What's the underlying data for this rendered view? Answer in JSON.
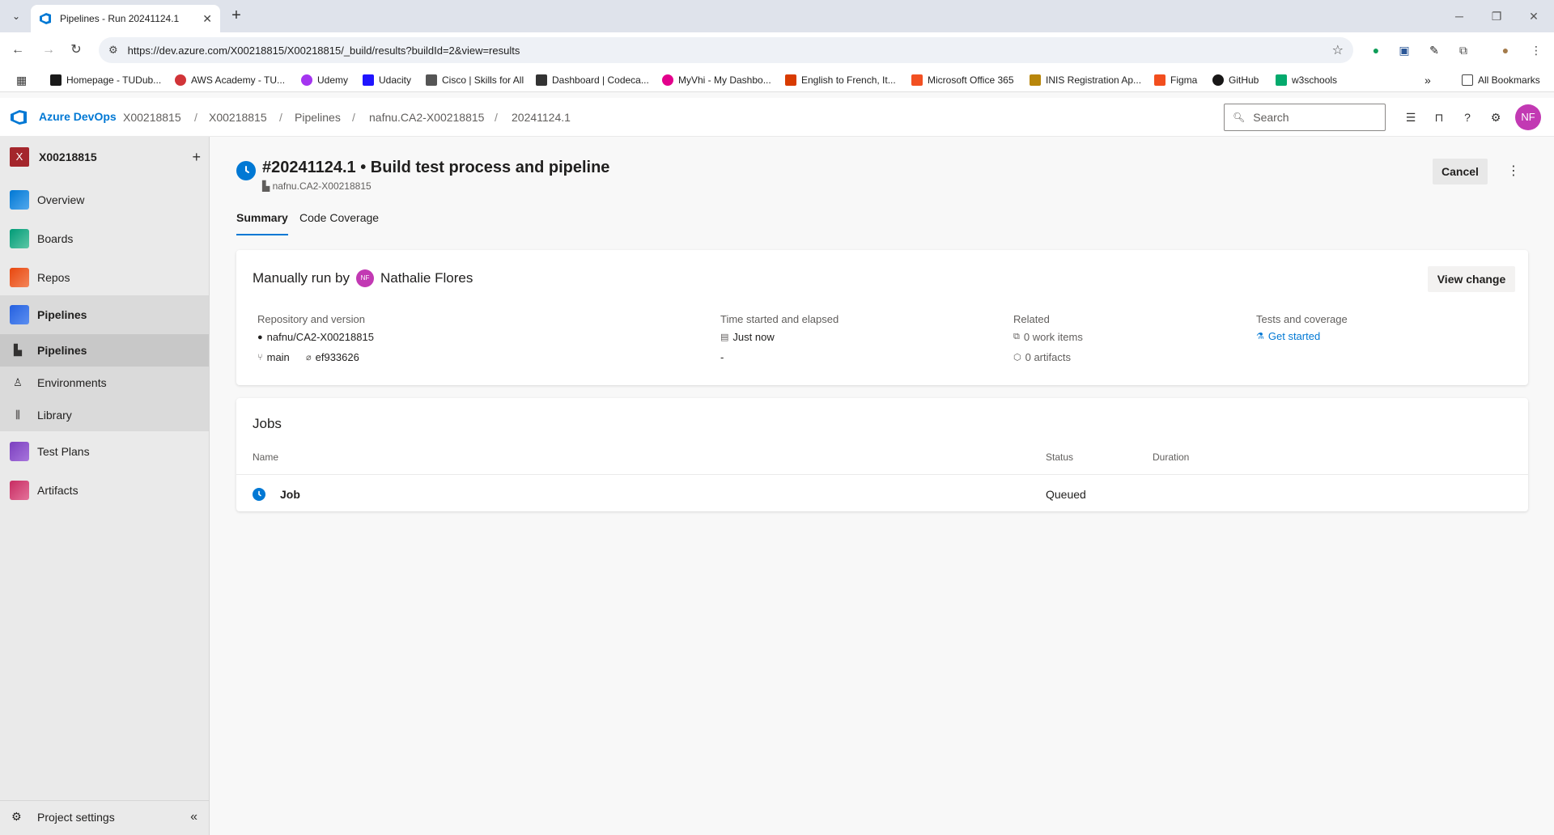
{
  "browser": {
    "tab_title": "Pipelines - Run 20241124.1",
    "url": "https://dev.azure.com/X00218815/X00218815/_build/results?buildId=2&view=results",
    "bookmarks": [
      {
        "label": "Homepage - TUDub...",
        "color": "#1a1a1a"
      },
      {
        "label": "AWS Academy - TU...",
        "color": "#d13438"
      },
      {
        "label": "Udemy",
        "color": "#a435f0"
      },
      {
        "label": "Udacity",
        "color": "#2015ff"
      },
      {
        "label": "Cisco | Skills for All",
        "color": "#555555"
      },
      {
        "label": "Dashboard | Codeca...",
        "color": "#333333"
      },
      {
        "label": "MyVhi - My Dashbo...",
        "color": "#e3008c"
      },
      {
        "label": "English to French, It...",
        "color": "#d83b01"
      },
      {
        "label": "Microsoft Office 365",
        "color": "#f25022"
      },
      {
        "label": "INIS Registration Ap...",
        "color": "#b8860b"
      },
      {
        "label": "Figma",
        "color": "#f24e1e"
      },
      {
        "label": "GitHub",
        "color": "#181717"
      },
      {
        "label": "w3schools",
        "color": "#04aa6d"
      }
    ],
    "all_bookmarks": "All Bookmarks"
  },
  "header": {
    "brand": "Azure DevOps",
    "breadcrumbs": [
      "X00218815",
      "X00218815",
      "Pipelines",
      "nafnu.CA2-X00218815",
      "20241124.1"
    ],
    "search_placeholder": "Search",
    "user_initials": "NF"
  },
  "sidebar": {
    "project_initial": "X",
    "project_name": "X00218815",
    "items": [
      {
        "label": "Overview",
        "icon": "overview-icon",
        "color": "#0078d4"
      },
      {
        "label": "Boards",
        "icon": "boards-icon",
        "color": "#009b77"
      },
      {
        "label": "Repos",
        "icon": "repos-icon",
        "color": "#e8470e"
      },
      {
        "label": "Pipelines",
        "icon": "pipelines-icon",
        "color": "#2560e0"
      },
      {
        "label": "Test Plans",
        "icon": "test-plans-icon",
        "color": "#7b3fbf"
      },
      {
        "label": "Artifacts",
        "icon": "artifacts-icon",
        "color": "#c72c62"
      }
    ],
    "sub_items": [
      "Pipelines",
      "Environments",
      "Library"
    ],
    "project_settings": "Project settings"
  },
  "run": {
    "title": "#20241124.1 • Build test process and pipeline",
    "subtitle": "nafnu.CA2-X00218815",
    "cancel_label": "Cancel",
    "tabs": [
      "Summary",
      "Code Coverage"
    ]
  },
  "summary": {
    "manual_prefix": "Manually run by",
    "user_initials": "NF",
    "user_name": "Nathalie Flores",
    "view_change": "View change",
    "repo_label": "Repository and version",
    "repo": "nafnu/CA2-X00218815",
    "branch": "main",
    "commit": "ef933626",
    "time_label": "Time started and elapsed",
    "started": "Just now",
    "elapsed": "-",
    "related_label": "Related",
    "work_items": "0 work items",
    "artifacts": "0 artifacts",
    "tests_label": "Tests and coverage",
    "get_started": "Get started"
  },
  "jobs": {
    "title": "Jobs",
    "columns": [
      "Name",
      "Status",
      "Duration"
    ],
    "rows": [
      {
        "name": "Job",
        "status": "Queued",
        "duration": ""
      }
    ]
  },
  "colors": {
    "accent": "#0078d4",
    "avatar": "#c239b3",
    "project_badge": "#a4262c"
  }
}
